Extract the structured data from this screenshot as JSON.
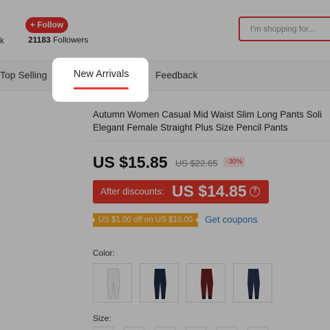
{
  "store_header": {
    "truncated_text": "k",
    "follow_label": "+ Follow",
    "followers_count": "21183",
    "followers_label": "Followers",
    "search_placeholder": "I'm shopping for..."
  },
  "nav": {
    "tabs": [
      {
        "label": "Top Selling",
        "active": false
      },
      {
        "label": "New Arrivals",
        "active": true
      },
      {
        "label": "Feedback",
        "active": false
      }
    ]
  },
  "product": {
    "title_line1": "Autumn Women Casual Mid Waist Slim Long Pants Soli",
    "title_line2": "Elegant Female Straight Plus Size Pencil Pants",
    "price": "US $15.85",
    "original_price": "US $22.65",
    "discount_badge": "-30%",
    "after_discount_label": "After discounts:",
    "after_discount_price": "US $14.85",
    "help_glyph": "?",
    "coupon_text": "US $1.00 off on US $10.00",
    "get_coupons_label": "Get coupons",
    "color_label": "Color:",
    "size_label": "Size:",
    "colors": [
      {
        "name": "white",
        "hex": "#f2f2f2"
      },
      {
        "name": "navy",
        "hex": "#1f2a44"
      },
      {
        "name": "wine",
        "hex": "#6e1e1e"
      },
      {
        "name": "dark-blue",
        "hex": "#26324f"
      }
    ]
  },
  "colors": {
    "accent": "#e62e2e",
    "link": "#2a7dc6",
    "coupon": "#f7a825"
  }
}
